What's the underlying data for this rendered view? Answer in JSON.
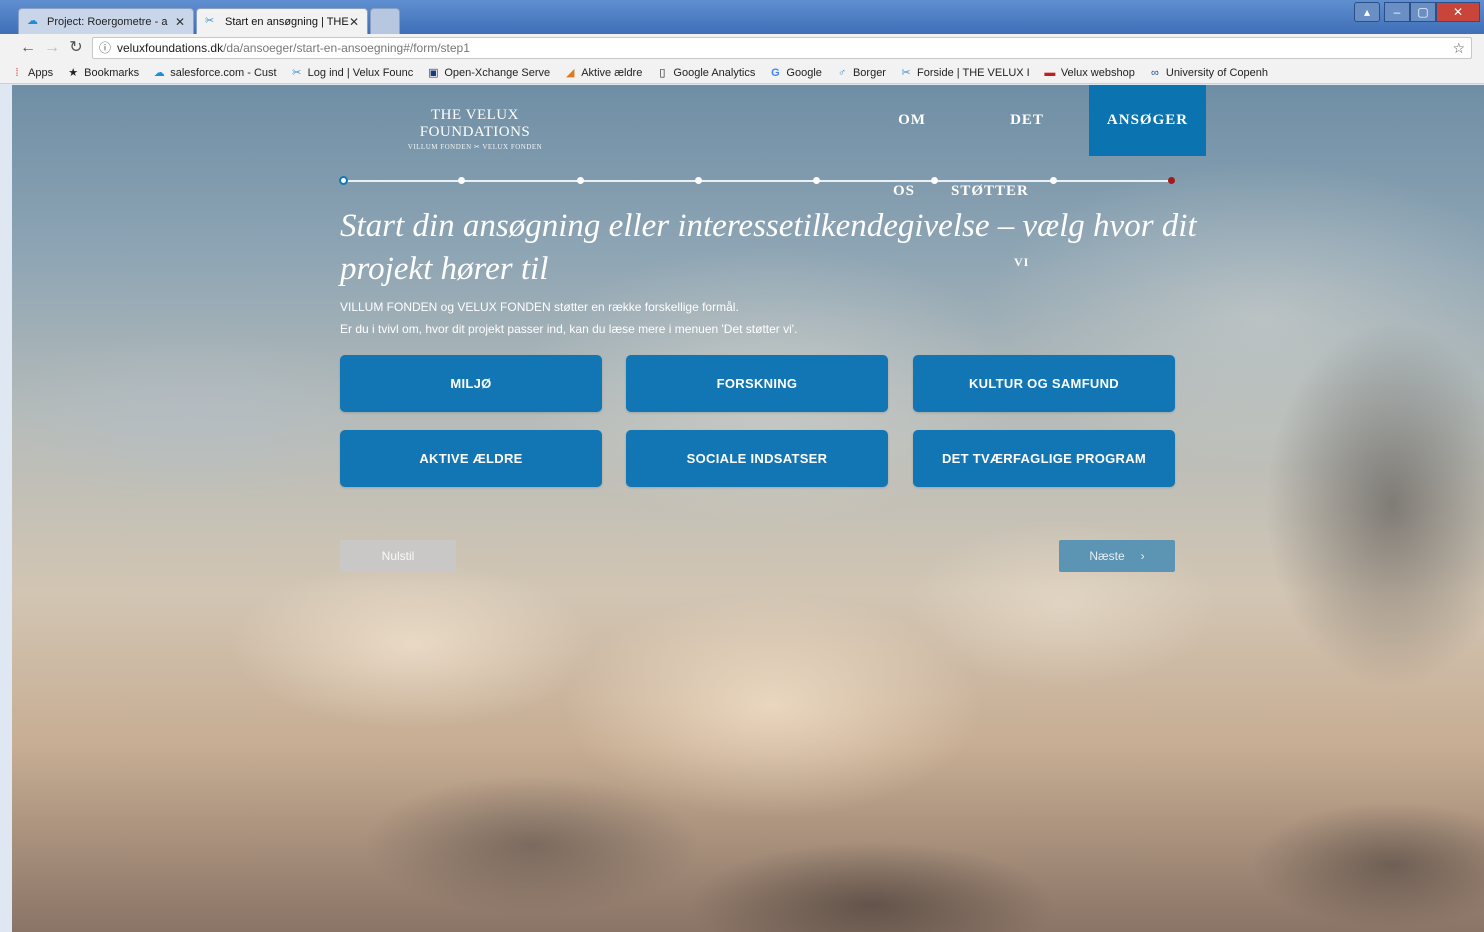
{
  "browser": {
    "tabs": [
      {
        "title": "Project: Roergometre - a",
        "icon": "salesforce-cloud-icon",
        "active": false
      },
      {
        "title": "Start en ansøgning | THE",
        "icon": "velux-foundations-icon",
        "active": true
      }
    ],
    "address": {
      "host": "veluxfoundations.dk",
      "path": "/da/ansoeger/start-en-ansoegning#/form/step1"
    },
    "bookmarks": [
      {
        "label": "Apps",
        "icon": "apps-grid-icon"
      },
      {
        "label": "Bookmarks",
        "icon": "star-icon"
      },
      {
        "label": "salesforce.com - Cust",
        "icon": "salesforce-cloud-icon"
      },
      {
        "label": "Log ind | Velux Founc",
        "icon": "velux-foundations-icon"
      },
      {
        "label": "Open-Xchange Serve",
        "icon": "open-xchange-icon"
      },
      {
        "label": "Aktive ældre",
        "icon": "aktive-aeldre-icon"
      },
      {
        "label": "Google Analytics",
        "icon": "page-icon"
      },
      {
        "label": "Google",
        "icon": "google-icon"
      },
      {
        "label": "Borger",
        "icon": "borger-icon"
      },
      {
        "label": "Forside | THE VELUX I",
        "icon": "velux-foundations-icon"
      },
      {
        "label": "Velux webshop",
        "icon": "velux-webshop-icon"
      },
      {
        "label": "University of Copenh",
        "icon": "university-icon"
      }
    ]
  },
  "site": {
    "logo_main": "THE VELUX FOUNDATIONS",
    "logo_sub": "VILLUM FONDEN ✂ VELUX FONDEN",
    "nav": {
      "om_line1": "OM",
      "om_line2": "OS",
      "det_line1": "DET",
      "det_line2": "STØTTER",
      "det_line3": "VI",
      "ansoeger": "ANSØGER"
    }
  },
  "form": {
    "steps_total": 8,
    "current_step": 1,
    "headline": "Start din ansøgning eller interessetilkendegivelse – vælg hvor dit projekt hører til",
    "intro_line1": "VILLUM FONDEN og VELUX FONDEN støtter en række forskellige formål.",
    "intro_line2": "Er du i tvivl om, hvor dit projekt passer ind, kan du læse mere i menuen 'Det støtter vi'.",
    "categories": [
      "MILJØ",
      "FORSKNING",
      "KULTUR OG SAMFUND",
      "AKTIVE ÆLDRE",
      "SOCIALE INDSATSER",
      "DET TVÆRFAGLIGE PROGRAM"
    ],
    "reset_label": "Nulstil",
    "next_label": "Næste",
    "accent_color": "#1176b3"
  }
}
